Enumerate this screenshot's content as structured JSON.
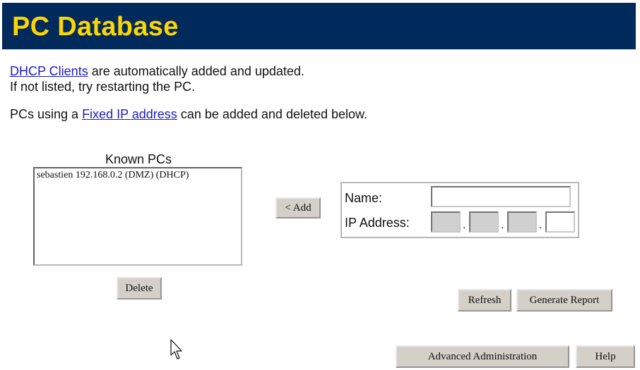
{
  "header": {
    "title": "PC Database"
  },
  "intro": {
    "dhcp_link": "DHCP Clients",
    "dhcp_text": " are automatically added and updated.",
    "restart_text": "If not listed, try restarting the PC.",
    "fixed_prefix": "PCs using a ",
    "fixed_link": "Fixed IP address",
    "fixed_suffix": " can be added and deleted below."
  },
  "known_pcs": {
    "title": "Known PCs",
    "items": [
      "sebastien 192.168.0.2 (DMZ) (DHCP)"
    ]
  },
  "buttons": {
    "add": "< Add",
    "delete": "Delete",
    "refresh": "Refresh",
    "generate_report": "Generate Report",
    "advanced_admin": "Advanced Administration",
    "help": "Help"
  },
  "form": {
    "name_label": "Name:",
    "name_value": "",
    "ip_label": "IP Address:",
    "ip_octets": [
      "",
      "",
      "",
      ""
    ],
    "ip_separator": "."
  },
  "colors": {
    "header_bg": "#002a5c",
    "header_text": "#ffd500",
    "link": "#1a1acc"
  }
}
